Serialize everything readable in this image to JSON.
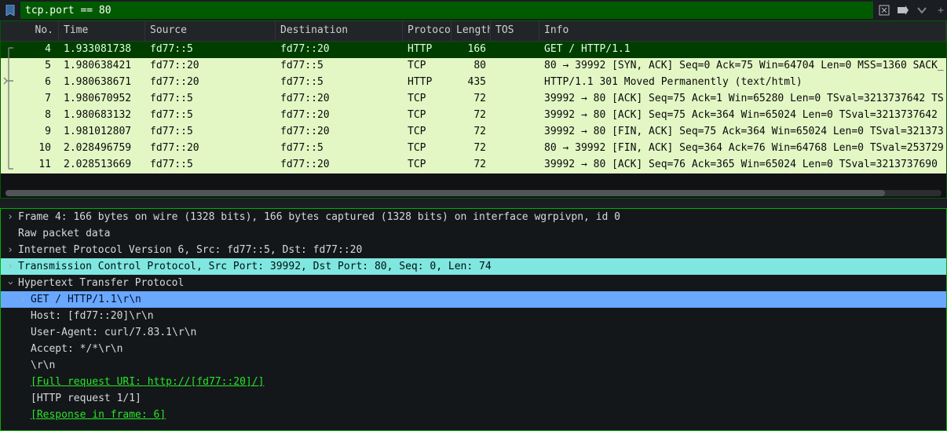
{
  "filter": {
    "value": "tcp.port == 80"
  },
  "columns": [
    "No.",
    "Time",
    "Source",
    "Destination",
    "Protocol",
    "Length",
    "TOS",
    "Info"
  ],
  "rows": [
    {
      "no": "4",
      "time": "1.933081738",
      "src": "fd77::5",
      "dst": "fd77::20",
      "proto": "HTTP",
      "len": "166",
      "tos": "",
      "info": "GET / HTTP/1.1",
      "selected": true
    },
    {
      "no": "5",
      "time": "1.980638421",
      "src": "fd77::20",
      "dst": "fd77::5",
      "proto": "TCP",
      "len": "80",
      "tos": "",
      "info": "80 → 39992 [SYN, ACK] Seq=0 Ack=75 Win=64704 Len=0 MSS=1360 SACK_"
    },
    {
      "no": "6",
      "time": "1.980638671",
      "src": "fd77::20",
      "dst": "fd77::5",
      "proto": "HTTP",
      "len": "435",
      "tos": "",
      "info": "HTTP/1.1 301 Moved Permanently  (text/html)"
    },
    {
      "no": "7",
      "time": "1.980670952",
      "src": "fd77::5",
      "dst": "fd77::20",
      "proto": "TCP",
      "len": "72",
      "tos": "",
      "info": "39992 → 80 [ACK] Seq=75 Ack=1 Win=65280 Len=0 TSval=3213737642 TS"
    },
    {
      "no": "8",
      "time": "1.980683132",
      "src": "fd77::5",
      "dst": "fd77::20",
      "proto": "TCP",
      "len": "72",
      "tos": "",
      "info": "39992 → 80 [ACK] Seq=75 Ack=364 Win=65024 Len=0 TSval=3213737642 "
    },
    {
      "no": "9",
      "time": "1.981012807",
      "src": "fd77::5",
      "dst": "fd77::20",
      "proto": "TCP",
      "len": "72",
      "tos": "",
      "info": "39992 → 80 [FIN, ACK] Seq=75 Ack=364 Win=65024 Len=0 TSval=321373"
    },
    {
      "no": "10",
      "time": "2.028496759",
      "src": "fd77::20",
      "dst": "fd77::5",
      "proto": "TCP",
      "len": "72",
      "tos": "",
      "info": "80 → 39992 [FIN, ACK] Seq=364 Ack=76 Win=64768 Len=0 TSval=253729"
    },
    {
      "no": "11",
      "time": "2.028513669",
      "src": "fd77::5",
      "dst": "fd77::20",
      "proto": "TCP",
      "len": "72",
      "tos": "",
      "info": "39992 → 80 [ACK] Seq=76 Ack=365 Win=65024 Len=0 TSval=3213737690 "
    }
  ],
  "details": {
    "frame": "Frame 4: 166 bytes on wire (1328 bits), 166 bytes captured (1328 bits) on interface wgrpivpn, id 0",
    "raw": "Raw packet data",
    "ip6": "Internet Protocol Version 6, Src: fd77::5, Dst: fd77::20",
    "tcp": "Transmission Control Protocol, Src Port: 39992, Dst Port: 80, Seq: 0, Len: 74",
    "http": "Hypertext Transfer Protocol",
    "reqline": "GET / HTTP/1.1\\r\\n",
    "host": "Host: [fd77::20]\\r\\n",
    "ua": "User-Agent: curl/7.83.1\\r\\n",
    "accept": "Accept: */*\\r\\n",
    "crlf": "\\r\\n",
    "fulluri": "[Full request URI: http://[fd77::20]/]",
    "reqno": "[HTTP request 1/1]",
    "resp": "[Response in frame: 6]"
  }
}
